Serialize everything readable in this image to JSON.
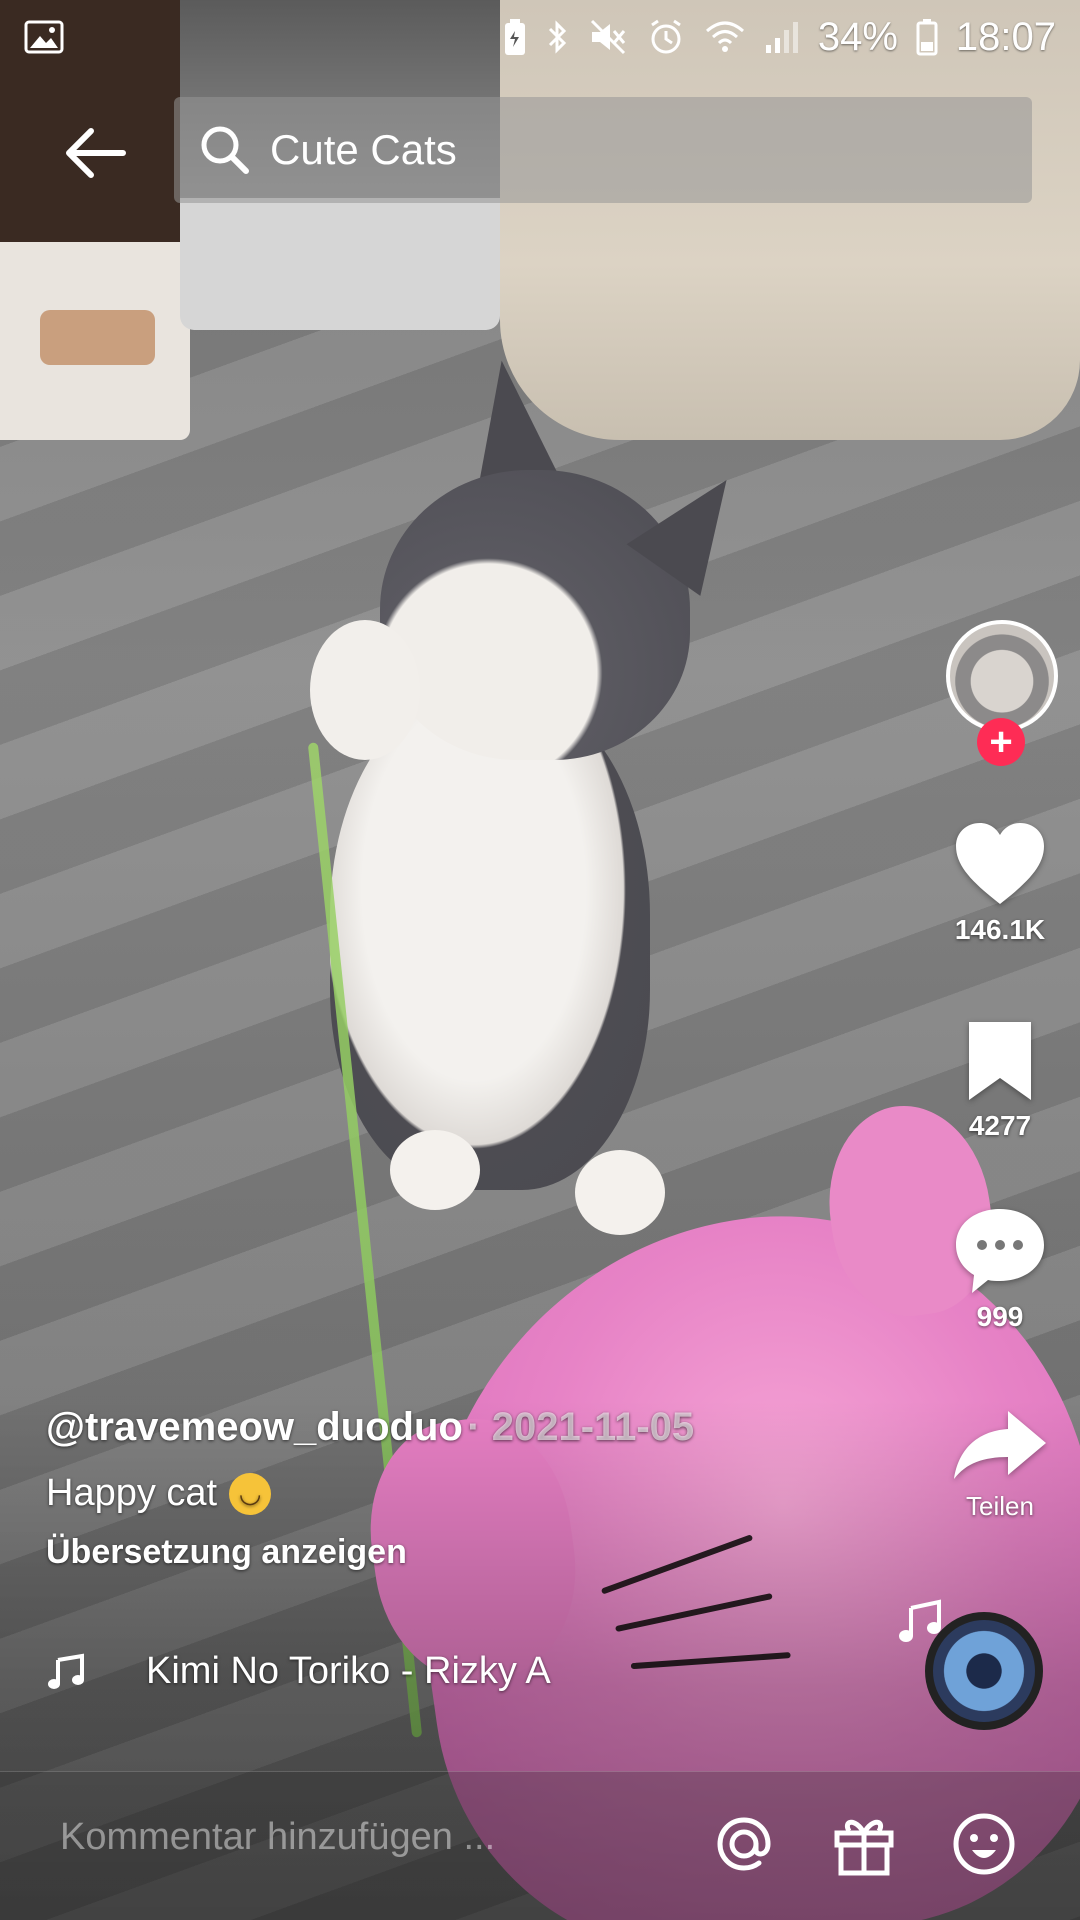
{
  "status_bar": {
    "battery_percent": "34%",
    "time": "18:07"
  },
  "search": {
    "query": "Cute Cats"
  },
  "rail": {
    "likes": "146.1K",
    "saves": "4277",
    "comments": "999",
    "share_label": "Teilen"
  },
  "caption": {
    "username": "@travemeow_duoduo",
    "date": "· 2021-11-05",
    "description": "Happy cat",
    "translate_label": "Übersetzung anzeigen"
  },
  "music": {
    "track": "Kimi No Toriko - Rizky A"
  },
  "comment_bar": {
    "placeholder": "Kommentar hinzufügen ..."
  },
  "colors": {
    "follow_badge": "#fe2c55"
  }
}
